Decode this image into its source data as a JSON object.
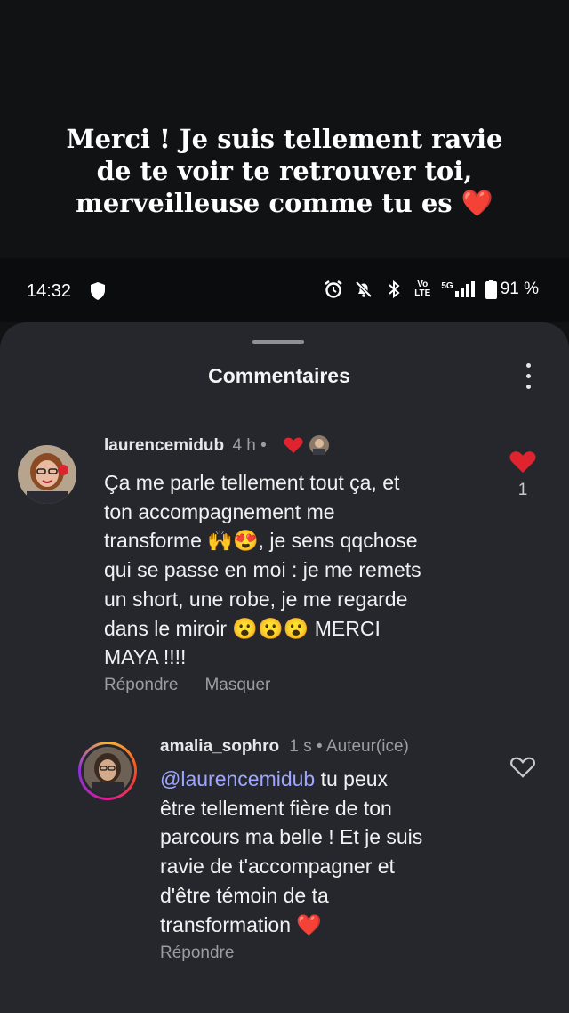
{
  "overlay": {
    "line1": "Merci ! Je suis tellement ravie",
    "line2": "de te voir te retrouver toi,",
    "line3": "merveilleuse comme tu es",
    "heart": "❤️"
  },
  "status_bar": {
    "time": "14:32",
    "volte_top": "Vo",
    "volte_bottom": "LTE",
    "network": "5G",
    "battery": "91 %"
  },
  "sheet": {
    "title": "Commentaires"
  },
  "comments": [
    {
      "username": "laurencemidub",
      "time": "4 h",
      "separator": "•",
      "body": [
        "Ça me parle tellement tout ça,  et",
        "ton accompagnement me",
        "transforme 🙌😍, je sens qqchose",
        "qui se passe en moi : je me remets",
        "un short, une robe, je me regarde",
        "dans le miroir 😮😮😮 MERCI",
        "MAYA !!!!"
      ],
      "reply_label": "Répondre",
      "hide_label": "Masquer",
      "like_count": "1"
    },
    {
      "username": "amalia_sophro",
      "time": "1 s",
      "separator": "•",
      "badge": "Auteur(ice)",
      "mention": "@laurencemidub",
      "body_first": " tu peux",
      "body": [
        "être tellement fière de ton",
        "parcours ma belle ! Et je suis",
        "ravie de t'accompagner et",
        "d'être témoin de ta",
        "transformation ❤️"
      ],
      "reply_label": "Répondre"
    }
  ],
  "colors": {
    "background": "#111214",
    "sheet": "#25272d",
    "like_red": "#e0242f",
    "mention": "#9fa6ff"
  }
}
